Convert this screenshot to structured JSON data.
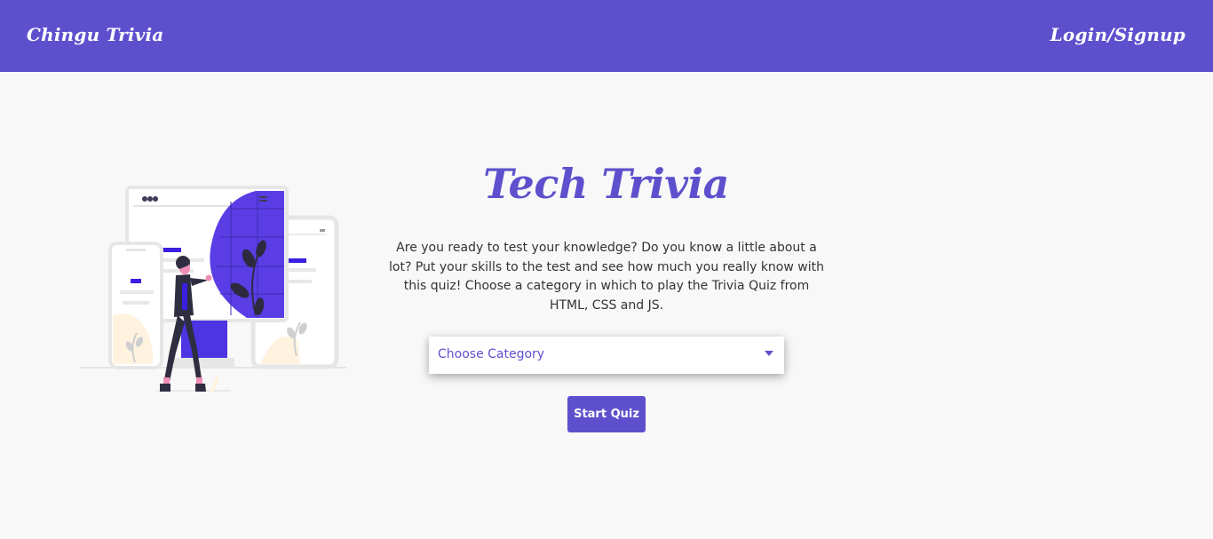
{
  "navbar": {
    "brand": "Chingu Trivia",
    "login_label": "Login/Signup"
  },
  "main": {
    "title": "Tech Trivia",
    "description": "Are you ready to test your knowledge? Do you know a little about a lot? Put your skills to the test and see how much you really know with this quiz! Choose a category in which to play the Trivia Quiz from HTML, CSS and JS.",
    "category_select": {
      "selected": "Choose Category",
      "icon": "caret-down-icon"
    },
    "start_label": "Start Quiz"
  },
  "illustration": {
    "icon": "person-with-devices-illustration"
  },
  "colors": {
    "accent": "#5e50cd",
    "background": "#f8f8f8",
    "text": "#333333"
  }
}
